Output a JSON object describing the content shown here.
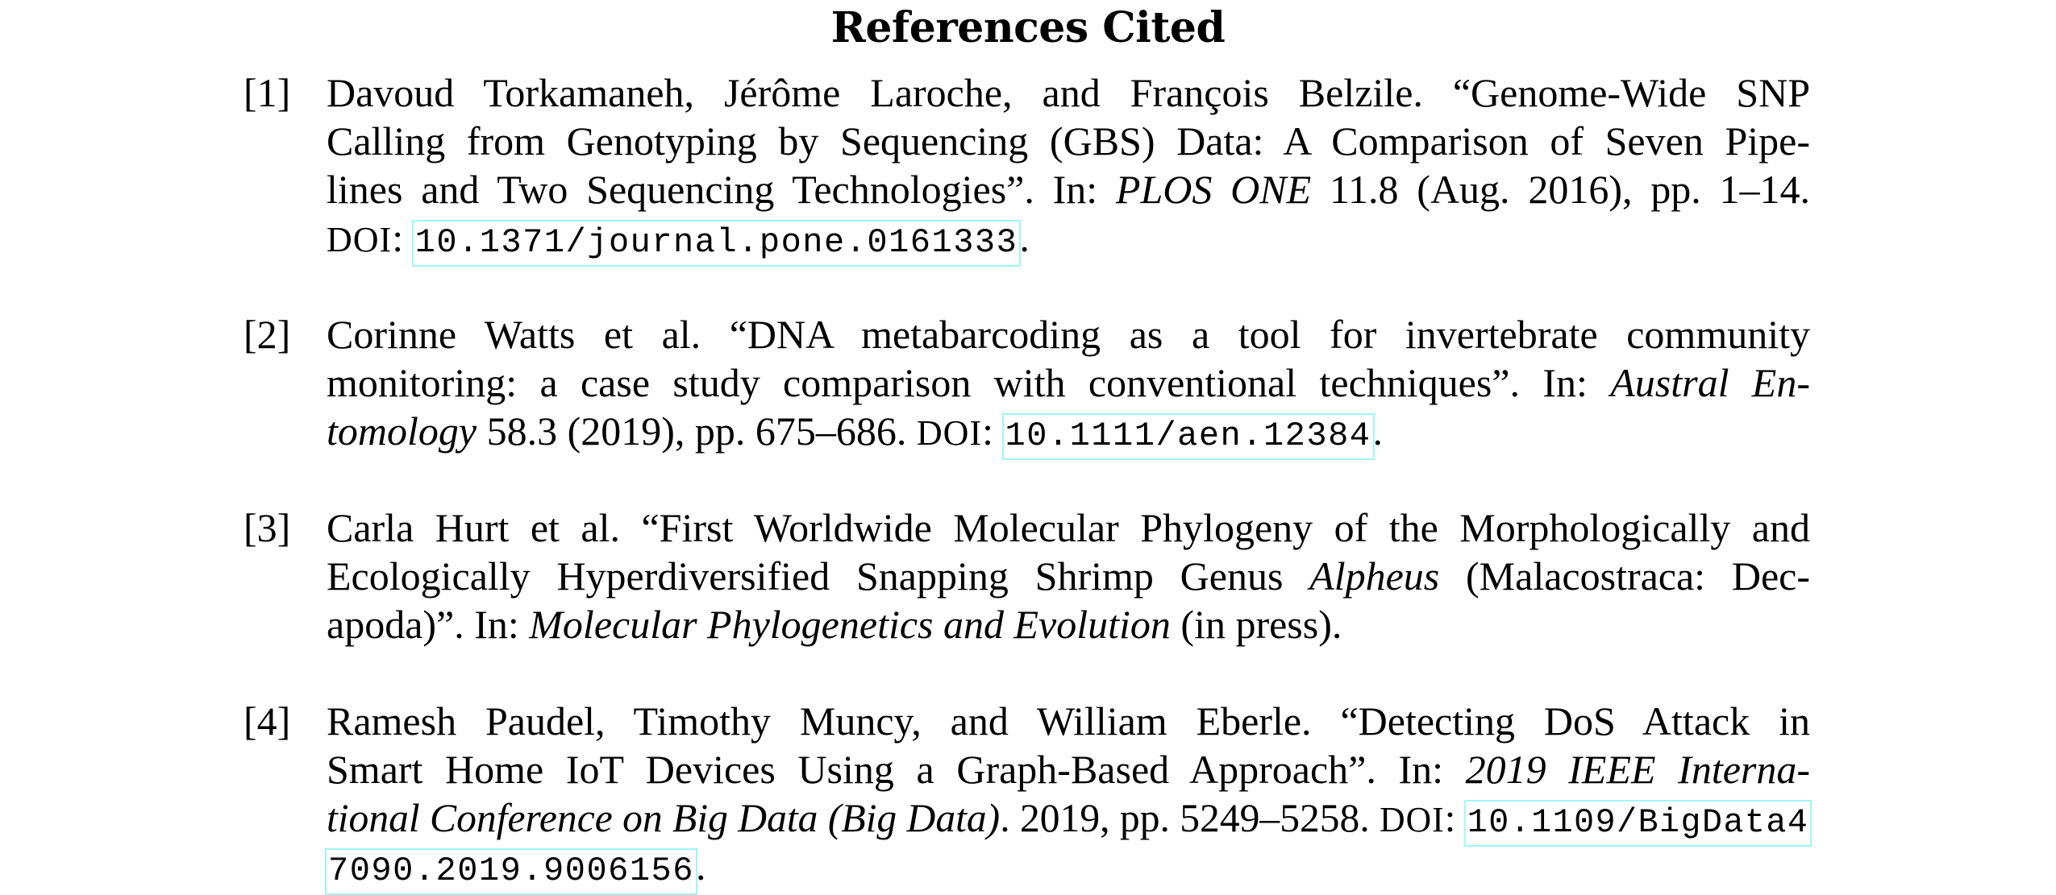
{
  "title": "References Cited",
  "doi_border_color": "#9ef7f7",
  "references": [
    {
      "label": "[1]",
      "lines": [
        [
          "Davoud Torkamaneh, Jérôme Laroche, and François Belzile. “Genome-Wide SNP"
        ],
        [
          "Calling from Genotyping by Sequencing (GBS) Data: A Comparison of Seven Pipe-"
        ],
        [
          "lines and Two Sequencing Technologies”. In: ",
          "PLOS ONE",
          " 11.8 (Aug. 2016), pp. 1–14."
        ],
        [
          "DOI",
          ": ",
          "10.1371/journal.pone.0161333",
          "."
        ]
      ],
      "authors": "Davoud Torkamaneh, Jérôme Laroche, and François Belzile",
      "title": "Genome-Wide SNP Calling from Genotyping by Sequencing (GBS) Data: A Comparison of Seven Pipelines and Two Sequencing Technologies",
      "venue": "PLOS ONE",
      "details": "11.8 (Aug. 2016), pp. 1–14.",
      "doi_label": "DOI",
      "doi": "10.1371/journal.pone.0161333"
    },
    {
      "label": "[2]",
      "lines": [
        [
          "Corinne Watts et al. “DNA metabarcoding as a tool for invertebrate community"
        ],
        [
          "monitoring: a case study comparison with conventional techniques”. In: ",
          "Austral En-"
        ],
        [
          "tomology",
          " 58.3 (2019), pp. 675–686. ",
          "DOI",
          ": ",
          "10.1111/aen.12384",
          "."
        ]
      ],
      "authors": "Corinne Watts et al.",
      "title": "DNA metabarcoding as a tool for invertebrate community monitoring: a case study comparison with conventional techniques",
      "venue": "Austral Entomology",
      "details": "58.3 (2019), pp. 675–686.",
      "doi_label": "DOI",
      "doi": "10.1111/aen.12384"
    },
    {
      "label": "[3]",
      "lines": [
        [
          "Carla Hurt et al. “First Worldwide Molecular Phylogeny of the Morphologically and"
        ],
        [
          "Ecologically Hyperdiversified Snapping Shrimp Genus ",
          "Alpheus",
          " (Malacostraca: Dec-"
        ],
        [
          "apoda)”. In: ",
          "Molecular Phylogenetics and Evolution",
          " (in press)."
        ]
      ],
      "authors": "Carla Hurt et al.",
      "title": "First Worldwide Molecular Phylogeny of the Morphologically and Ecologically Hyperdiversified Snapping Shrimp Genus Alpheus (Malacostraca: Decapoda)",
      "venue": "Molecular Phylogenetics and Evolution",
      "details": "(in press)."
    },
    {
      "label": "[4]",
      "lines": [
        [
          "Ramesh Paudel, Timothy Muncy, and William Eberle. “Detecting DoS Attack in"
        ],
        [
          "Smart Home IoT Devices Using a Graph-Based Approach”. In: ",
          "2019 IEEE Interna-"
        ],
        [
          "tional Conference on Big Data (Big Data)",
          ". 2019, pp. 5249–5258. ",
          "DOI",
          ": ",
          "10.1109/BigData4"
        ],
        [
          "7090.2019.9006156",
          "."
        ]
      ],
      "authors": "Ramesh Paudel, Timothy Muncy, and William Eberle",
      "title": "Detecting DoS Attack in Smart Home IoT Devices Using a Graph-Based Approach",
      "venue": "2019 IEEE International Conference on Big Data (Big Data)",
      "details": "2019, pp. 5249–5258.",
      "doi_label": "DOI",
      "doi": "10.1109/BigData47090.2019.9006156"
    }
  ]
}
